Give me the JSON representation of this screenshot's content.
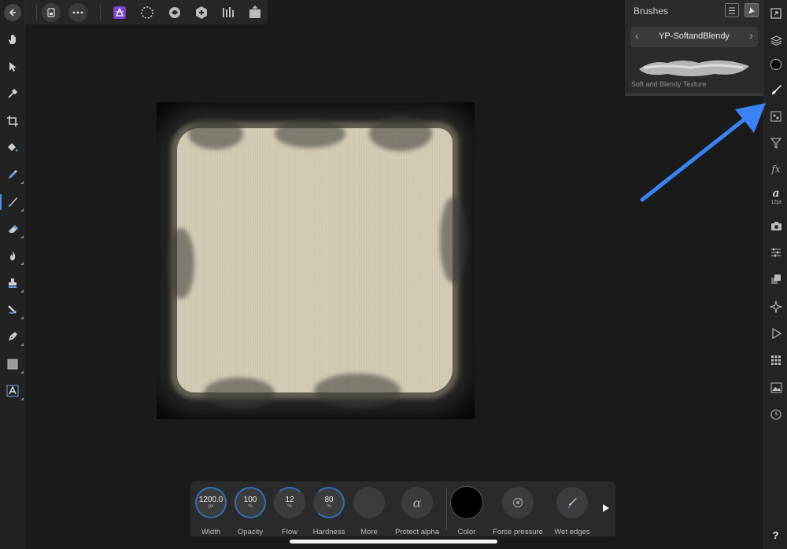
{
  "brushes_panel": {
    "title": "Brushes",
    "category": "YP-SoftandBlendy",
    "brush_name": "Soft and Blendy Texture"
  },
  "context_toolbar": {
    "width": {
      "value": "1200.0",
      "unit": "px",
      "label": "Width"
    },
    "opacity": {
      "value": "100",
      "unit": "%",
      "label": "Opacity"
    },
    "flow": {
      "value": "12",
      "unit": "%",
      "label": "Flow"
    },
    "hardness": {
      "value": "80",
      "unit": "%",
      "label": "Hardness"
    },
    "more_label": "More",
    "protect_alpha_label": "Protect alpha",
    "color_label": "Color",
    "force_pressure_label": "Force pressure",
    "wet_edges_label": "Wet edges",
    "protect_alpha_glyph": "α",
    "current_color": "#000000"
  },
  "studio": {
    "text_size_label": "12pt",
    "help_label": "?"
  },
  "colors": {
    "accent_blue": "#3b82f6",
    "paper": "#d3cbb5"
  }
}
